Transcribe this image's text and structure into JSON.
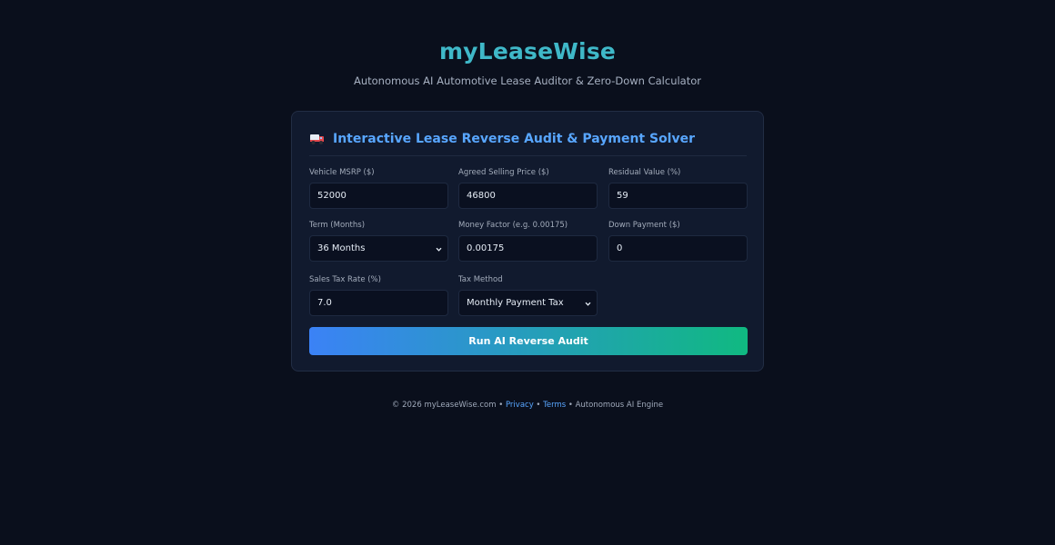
{
  "header": {
    "brand": "myLeaseWise",
    "tagline": "Autonomous AI Automotive Lease Auditor & Zero-Down Calculator"
  },
  "card": {
    "icon": "truck-icon",
    "title": "Interactive Lease Reverse Audit & Payment Solver",
    "fields": {
      "msrp": {
        "label": "Vehicle MSRP ($)",
        "value": "52000"
      },
      "selling_price": {
        "label": "Agreed Selling Price ($)",
        "value": "46800"
      },
      "residual": {
        "label": "Residual Value (%)",
        "value": "59"
      },
      "term": {
        "label": "Term (Months)",
        "value": "36 Months"
      },
      "money_factor": {
        "label": "Money Factor (e.g. 0.00175)",
        "value": "0.00175"
      },
      "down_payment": {
        "label": "Down Payment ($)",
        "value": "0"
      },
      "sales_tax": {
        "label": "Sales Tax Rate (%)",
        "value": "7.0"
      },
      "tax_method": {
        "label": "Tax Method",
        "value": "Monthly Payment Tax"
      }
    },
    "submit_label": "Run AI Reverse Audit",
    "colors": {
      "accent": "#58a6ff",
      "brand": "#3fb8c8",
      "button_start": "#3b82f6",
      "button_end": "#10b981"
    }
  },
  "footer": {
    "copyright": "© 2026 myLeaseWise.com",
    "sep1": " • ",
    "privacy": "Privacy",
    "sep2": " • ",
    "terms": "Terms",
    "sep3": " • ",
    "engine": "Autonomous AI Engine"
  }
}
